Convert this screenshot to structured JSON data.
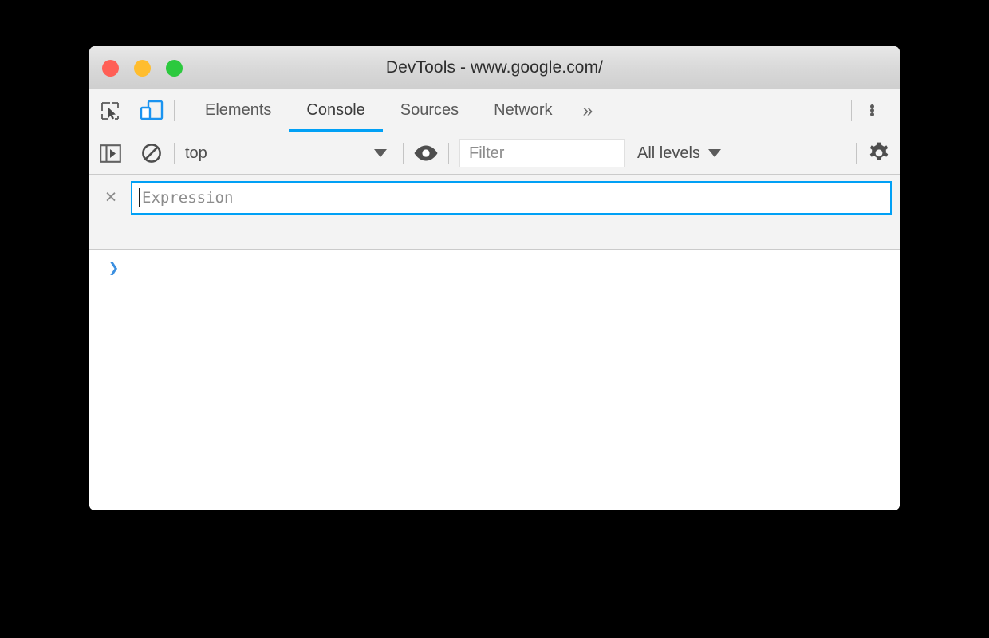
{
  "window": {
    "title": "DevTools - www.google.com/",
    "traffic_lights": [
      {
        "name": "close",
        "color": "#ff5f56"
      },
      {
        "name": "minimize",
        "color": "#ffbd2e"
      },
      {
        "name": "zoom",
        "color": "#2cc93e"
      }
    ]
  },
  "tabbar": {
    "icons": [
      {
        "name": "inspect-element-icon",
        "label": "Inspect element"
      },
      {
        "name": "device-toolbar-icon",
        "label": "Toggle device toolbar",
        "color": "#1a93f0",
        "active": true
      }
    ],
    "tabs": [
      {
        "label": "Elements",
        "active": false
      },
      {
        "label": "Console",
        "active": true
      },
      {
        "label": "Sources",
        "active": false
      },
      {
        "label": "Network",
        "active": false
      }
    ],
    "more_tabs_label": "»",
    "menu_label": "Customize and control DevTools",
    "active_underline_color": "#00a0f5"
  },
  "console_toolbar": {
    "sidebar_toggle_label": "Show console sidebar",
    "clear_console_label": "Clear console",
    "context": {
      "value": "top",
      "caret": "▼"
    },
    "live_expression_label": "Create live expression",
    "filter": {
      "value": "",
      "placeholder": "Filter"
    },
    "levels": {
      "value": "All levels",
      "caret": "▼"
    },
    "settings_label": "Console settings"
  },
  "live_expression": {
    "close_label": "×",
    "input": {
      "value": "",
      "placeholder": "Expression"
    },
    "border_color": "#00a0f5"
  },
  "console_output": {
    "prompt": "❯",
    "prompt_color": "#3b8fe0",
    "messages": []
  }
}
